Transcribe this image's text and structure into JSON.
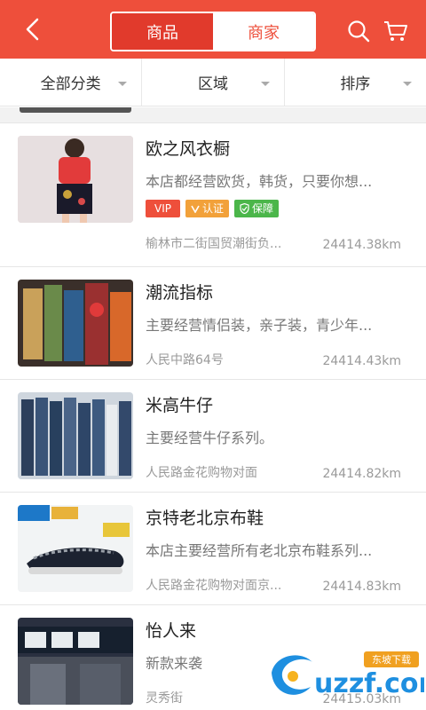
{
  "header": {
    "tabs": [
      {
        "label": "商品",
        "active": false
      },
      {
        "label": "商家",
        "active": true
      }
    ]
  },
  "filters": [
    {
      "label": "全部分类"
    },
    {
      "label": "区域"
    },
    {
      "label": "排序"
    }
  ],
  "shops": [
    {
      "name": "欧之风衣橱",
      "desc": "本店都经营欧货，韩货，只要你想...",
      "badges": [
        "VIP",
        "认证",
        "保障"
      ],
      "address": "榆林市二街国贸潮街负...",
      "distance": "24414.38km"
    },
    {
      "name": "潮流指标",
      "desc": "主要经营情侣装，亲子装，青少年...",
      "address": "人民中路64号",
      "distance": "24414.43km"
    },
    {
      "name": "米高牛仔",
      "desc": "主要经营牛仔系列。",
      "address": "人民路金花购物对面",
      "distance": "24414.82km"
    },
    {
      "name": "京特老北京布鞋",
      "desc": "本店主要经营所有老北京布鞋系列...",
      "address": "人民路金花购物对面京...",
      "distance": "24414.83km"
    },
    {
      "name": "怡人来",
      "desc": "新款来袭",
      "address": "灵秀街",
      "distance": "24415.03km"
    }
  ],
  "colors": {
    "brand": "#ee4f3b",
    "vip": "#ee4f3b",
    "auth": "#f2a13a",
    "guard": "#4bb64a"
  },
  "watermark": {
    "text": "uzzf.com",
    "sub": "东坡下载"
  }
}
